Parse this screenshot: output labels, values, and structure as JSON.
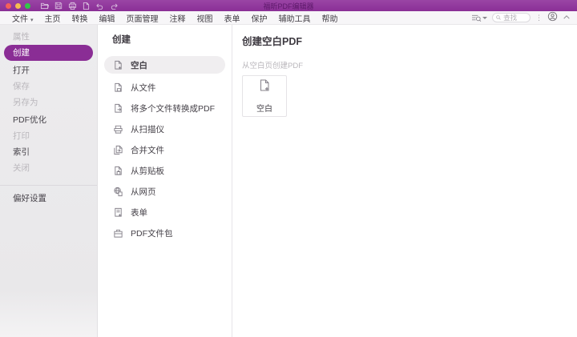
{
  "window": {
    "title": "福昕PDF编辑器",
    "traffic_lights": {
      "close": "close",
      "minimize": "minimize",
      "zoom": "zoom"
    },
    "quick_access": {
      "open": "open-file",
      "save": "save",
      "print": "print",
      "new_document": "new-document",
      "undo": "undo",
      "redo": "redo"
    }
  },
  "menu_bar": {
    "items": [
      {
        "label": "文件",
        "active": true,
        "has_chevron": true
      },
      {
        "label": "主页"
      },
      {
        "label": "转换"
      },
      {
        "label": "编辑"
      },
      {
        "label": "页面管理"
      },
      {
        "label": "注释"
      },
      {
        "label": "视图"
      },
      {
        "label": "表单"
      },
      {
        "label": "保护"
      },
      {
        "label": "辅助工具"
      },
      {
        "label": "帮助"
      }
    ],
    "search": {
      "placeholder": "查找"
    }
  },
  "sidebar": {
    "items": [
      {
        "label": "属性",
        "state": "disabled"
      },
      {
        "label": "创建",
        "state": "selected"
      },
      {
        "label": "打开",
        "state": "normal"
      },
      {
        "label": "保存",
        "state": "disabled"
      },
      {
        "label": "另存为",
        "state": "disabled"
      },
      {
        "label": "PDF优化",
        "state": "normal"
      },
      {
        "label": "打印",
        "state": "disabled"
      },
      {
        "label": "索引",
        "state": "normal"
      },
      {
        "label": "关闭",
        "state": "disabled"
      }
    ],
    "footer_item": {
      "label": "偏好设置"
    }
  },
  "create_panel": {
    "title": "创建",
    "items": [
      {
        "label": "空白",
        "icon": "document-plus",
        "selected": true
      },
      {
        "label": "从文件",
        "icon": "document-from-file"
      },
      {
        "label": "将多个文件转换成PDF",
        "icon": "documents-convert"
      },
      {
        "label": "从扫描仪",
        "icon": "scanner"
      },
      {
        "label": "合并文件",
        "icon": "merge-files"
      },
      {
        "label": "从剪贴板",
        "icon": "clipboard"
      },
      {
        "label": "从网页",
        "icon": "web-page"
      },
      {
        "label": "表单",
        "icon": "form"
      },
      {
        "label": "PDF文件包",
        "icon": "pdf-portfolio"
      }
    ]
  },
  "detail_panel": {
    "title": "创建空白PDF",
    "subtitle": "从空白页创建PDF",
    "card": {
      "label": "空白",
      "icon": "document-plus"
    }
  },
  "colors": {
    "titlebar": "#8a2f96",
    "accent": "#8a2d95",
    "selected_pill_gray": "#f0eef0",
    "disabled_text": "#bab7bc",
    "traffic_red": "#f4605a",
    "traffic_yellow": "#f5bd4f",
    "traffic_green": "#33c748"
  }
}
